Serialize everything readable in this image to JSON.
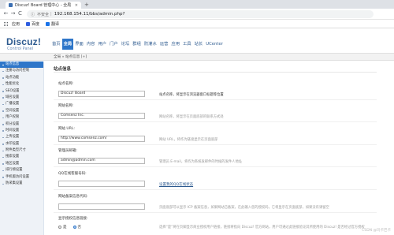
{
  "browser": {
    "tab_title": "Discuz! Board 管理中心 - 全局",
    "tab_close": "×",
    "new_tab": "+",
    "back": "←",
    "forward": "→",
    "reload": "C",
    "secure_label": "不安全",
    "url_separator": "|",
    "url": "192.168.154.11/bbs/admin.php?",
    "bookmarks": [
      {
        "label": "应用"
      },
      {
        "label": "百度",
        "color": "#2f5ee0"
      },
      {
        "label": "翻译",
        "color": "#1a73e8"
      }
    ]
  },
  "header": {
    "logo": "Discuz!",
    "logo_sub": "Control Panel",
    "nav": [
      "首页",
      "全局",
      "界面",
      "内容",
      "用户",
      "门户",
      "论坛",
      "群组",
      "防灌水",
      "运营",
      "应用",
      "工具",
      "站长",
      "UCenter"
    ],
    "active_nav_index": 1
  },
  "breadcrumb": "全局 » 站点信息 [+]",
  "sidebar": {
    "items": [
      "站点信息",
      "注册与访问控制",
      "站点功能",
      "性能优化",
      "SEO设置",
      "域名设置",
      "广播设置",
      "空间设置",
      "用户权限",
      "积分设置",
      "时间设置",
      "上传设置",
      "水印设置",
      "附件类型尺寸",
      "搜索设置",
      "地区设置",
      "排行榜设置",
      "手机版访问设置",
      "防采集设置"
    ],
    "active_index": 0
  },
  "main": {
    "section_title": "站点信息",
    "fields": [
      {
        "label": "站点名称:",
        "value": "Discuz! Board",
        "hint": "站点名称，将显示在浏览器窗口标题等位置",
        "hint_dark": true
      },
      {
        "label": "网站名称:",
        "value": "Comsenz Inc.",
        "hint": "网站名称，将显示在页面底部的联系方式处",
        "hint_dark": false
      },
      {
        "label": "网站 URL:",
        "value": "http://www.comsenz.com/",
        "hint": "网站 URL，将作为链接显示在页面底部",
        "hint_dark": false
      },
      {
        "label": "管理员邮箱:",
        "value": "admin@admin.com",
        "hint": "管理员 E-mail，将作为系统发邮件的时候的发件人地址",
        "hint_dark": false
      },
      {
        "label": "QQ在线客服号码:",
        "value": "",
        "link": "设置我的QQ在线状态"
      },
      {
        "label": "网站备案信息代码:",
        "value": "",
        "hint": "页面底部可以显示 ICP 备案信息，如果网站已备案，在此输入您的授权码，它将显示在页面底部，如果没有请留空",
        "hint_dark": false
      }
    ],
    "radio_field": {
      "label": "显示授权信息链接:",
      "options": [
        "是",
        "否"
      ],
      "checked_index": 1,
      "hint": "选择“是”将在页脚显示商业授权用户链接，链接将指向 Discuz! 官方网站，用户可通过此链接验证其所使用的 Discuz! 是否经过官方授权"
    }
  },
  "watermark": "CSDN @玛卡巴卡"
}
